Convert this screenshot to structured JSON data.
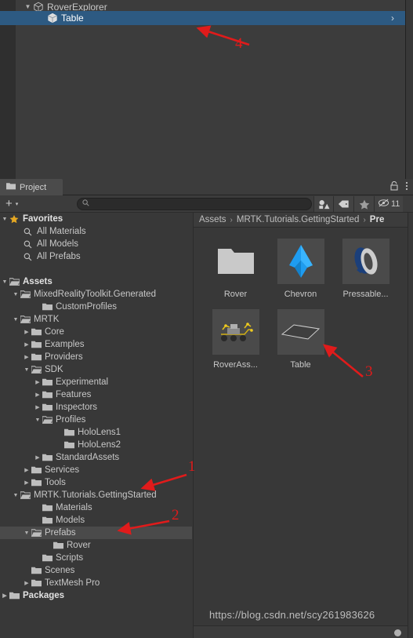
{
  "hierarchy": {
    "rows": [
      {
        "label": "RoverExplorer",
        "foldout": "▼",
        "indent": 30,
        "icon": "prefab-cube-icon",
        "selected": false,
        "chevron": false
      },
      {
        "label": "Table",
        "foldout": "",
        "indent": 60,
        "icon": "prefab-cube-icon",
        "selected": true,
        "chevron": true
      }
    ],
    "chevron_glyph": "›"
  },
  "project": {
    "tab_label": "Project",
    "lock_icon": "lock-icon",
    "menu_icon": "kebab-menu-icon",
    "toolbar": {
      "add_label": "+",
      "add_caret": "▾",
      "search_value": "",
      "search_placeholder": "",
      "search_icon": "search-icon",
      "filters": [
        {
          "name": "type-filter-icon",
          "glyph": "type"
        },
        {
          "name": "label-filter-icon",
          "glyph": "label"
        },
        {
          "name": "favorites-filter-icon",
          "glyph": "star"
        }
      ],
      "hidden_icon": "hidden-eye-icon",
      "hidden_count": "11"
    },
    "tree": [
      {
        "label": "Favorites",
        "indent": 0,
        "arrow": "▼",
        "icon": "star-icon",
        "bold": true,
        "selected": false
      },
      {
        "label": "All Materials",
        "indent": 18,
        "arrow": "",
        "icon": "search-icon",
        "bold": false,
        "selected": false
      },
      {
        "label": "All Models",
        "indent": 18,
        "arrow": "",
        "icon": "search-icon",
        "bold": false,
        "selected": false
      },
      {
        "label": "All Prefabs",
        "indent": 18,
        "arrow": "",
        "icon": "search-icon",
        "bold": false,
        "selected": false
      },
      {
        "label": "",
        "indent": 0,
        "arrow": "",
        "icon": "none",
        "bold": false,
        "selected": false
      },
      {
        "label": "Assets",
        "indent": 0,
        "arrow": "▼",
        "icon": "folder-open-icon",
        "bold": true,
        "selected": false
      },
      {
        "label": "MixedRealityToolkit.Generated",
        "indent": 14,
        "arrow": "▼",
        "icon": "folder-open-icon",
        "bold": false,
        "selected": false
      },
      {
        "label": "CustomProfiles",
        "indent": 42,
        "arrow": "",
        "icon": "folder-icon",
        "bold": false,
        "selected": false
      },
      {
        "label": "MRTK",
        "indent": 14,
        "arrow": "▼",
        "icon": "folder-open-icon",
        "bold": false,
        "selected": false
      },
      {
        "label": "Core",
        "indent": 28,
        "arrow": "▶",
        "icon": "folder-icon",
        "bold": false,
        "selected": false
      },
      {
        "label": "Examples",
        "indent": 28,
        "arrow": "▶",
        "icon": "folder-icon",
        "bold": false,
        "selected": false
      },
      {
        "label": "Providers",
        "indent": 28,
        "arrow": "▶",
        "icon": "folder-icon",
        "bold": false,
        "selected": false
      },
      {
        "label": "SDK",
        "indent": 28,
        "arrow": "▼",
        "icon": "folder-open-icon",
        "bold": false,
        "selected": false
      },
      {
        "label": "Experimental",
        "indent": 42,
        "arrow": "▶",
        "icon": "folder-icon",
        "bold": false,
        "selected": false
      },
      {
        "label": "Features",
        "indent": 42,
        "arrow": "▶",
        "icon": "folder-icon",
        "bold": false,
        "selected": false
      },
      {
        "label": "Inspectors",
        "indent": 42,
        "arrow": "▶",
        "icon": "folder-icon",
        "bold": false,
        "selected": false
      },
      {
        "label": "Profiles",
        "indent": 42,
        "arrow": "▼",
        "icon": "folder-open-icon",
        "bold": false,
        "selected": false
      },
      {
        "label": "HoloLens1",
        "indent": 70,
        "arrow": "",
        "icon": "folder-icon",
        "bold": false,
        "selected": false
      },
      {
        "label": "HoloLens2",
        "indent": 70,
        "arrow": "",
        "icon": "folder-icon",
        "bold": false,
        "selected": false
      },
      {
        "label": "StandardAssets",
        "indent": 42,
        "arrow": "▶",
        "icon": "folder-icon",
        "bold": false,
        "selected": false
      },
      {
        "label": "Services",
        "indent": 28,
        "arrow": "▶",
        "icon": "folder-icon",
        "bold": false,
        "selected": false
      },
      {
        "label": "Tools",
        "indent": 28,
        "arrow": "▶",
        "icon": "folder-icon",
        "bold": false,
        "selected": false
      },
      {
        "label": "MRTK.Tutorials.GettingStarted",
        "indent": 14,
        "arrow": "▼",
        "icon": "folder-open-icon",
        "bold": false,
        "selected": false
      },
      {
        "label": "Materials",
        "indent": 42,
        "arrow": "",
        "icon": "folder-icon",
        "bold": false,
        "selected": false
      },
      {
        "label": "Models",
        "indent": 42,
        "arrow": "",
        "icon": "folder-icon",
        "bold": false,
        "selected": false
      },
      {
        "label": "Prefabs",
        "indent": 28,
        "arrow": "▼",
        "icon": "folder-open-icon",
        "bold": false,
        "selected": true
      },
      {
        "label": "Rover",
        "indent": 56,
        "arrow": "",
        "icon": "folder-icon",
        "bold": false,
        "selected": false
      },
      {
        "label": "Scripts",
        "indent": 42,
        "arrow": "",
        "icon": "folder-icon",
        "bold": false,
        "selected": false
      },
      {
        "label": "Scenes",
        "indent": 28,
        "arrow": "",
        "icon": "folder-icon",
        "bold": false,
        "selected": false
      },
      {
        "label": "TextMesh Pro",
        "indent": 28,
        "arrow": "▶",
        "icon": "folder-icon",
        "bold": false,
        "selected": false
      },
      {
        "label": "Packages",
        "indent": 0,
        "arrow": "▶",
        "icon": "folder-icon",
        "bold": true,
        "selected": false
      }
    ],
    "breadcrumb": [
      {
        "label": "Assets",
        "current": false
      },
      {
        "label": "MRTK.Tutorials.GettingStarted",
        "current": false
      },
      {
        "label": "Pre",
        "current": true
      }
    ],
    "breadcrumb_separator": "›",
    "assets": [
      {
        "name": "Rover",
        "icon": "folder-large-icon"
      },
      {
        "name": "Chevron",
        "icon": "chevron-mesh-icon"
      },
      {
        "name": "Pressable...",
        "icon": "pressable-ring-icon"
      },
      {
        "name": "RoverAss...",
        "icon": "rover-model-icon"
      },
      {
        "name": "Table",
        "icon": "table-mesh-icon"
      }
    ],
    "watermark": "https://blog.csdn.net/scy261983626",
    "zoom_slider": "thumbnail-size-slider"
  },
  "annotations": [
    {
      "number": "1"
    },
    {
      "number": "2"
    },
    {
      "number": "3"
    },
    {
      "number": "4"
    }
  ],
  "colors": {
    "selection_blue": "#2d5a82",
    "annotation_red": "#e01b1b",
    "panel_bg": "#383838",
    "accent_star": "#e5a823"
  }
}
